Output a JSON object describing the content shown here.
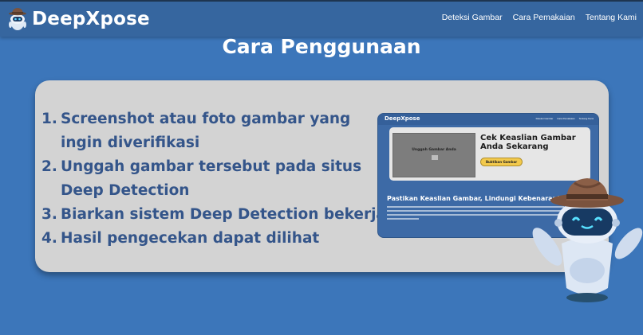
{
  "nav": {
    "brand": "DeepXpose",
    "links": [
      "Deteksi Gambar",
      "Cara Pemakaian",
      "Tentang Kami"
    ]
  },
  "page": {
    "title": "Cara Penggunaan"
  },
  "steps": [
    {
      "num": "1.",
      "text": "Screenshot atau foto gambar yang ingin diverifikasi"
    },
    {
      "num": "2.",
      "text": "Unggah gambar tersebut pada situs Deep Detection"
    },
    {
      "num": "3.",
      "text": "Biarkan sistem Deep Detection bekerja"
    },
    {
      "num": "4.",
      "text": "Hasil pengecekan dapat dilihat"
    }
  ],
  "preview": {
    "brand": "DeepXpose",
    "links": [
      "Deteksi Gambar",
      "Cara Pemakaian",
      "Tentang Kami"
    ],
    "upload_title": "Unggah Gambar Anda",
    "hero_title": "Cek Keaslian Gambar Anda Sekarang",
    "hero_button": "Buktikan Gambar",
    "subtitle": "Pastikan Keaslian Gambar, Lindungi Kebenaran!"
  },
  "colors": {
    "background": "#3c76ba",
    "navbar": "#36669f",
    "card": "#d3d3d3",
    "step_text": "#34558a",
    "accent_button": "#f2c94c"
  }
}
